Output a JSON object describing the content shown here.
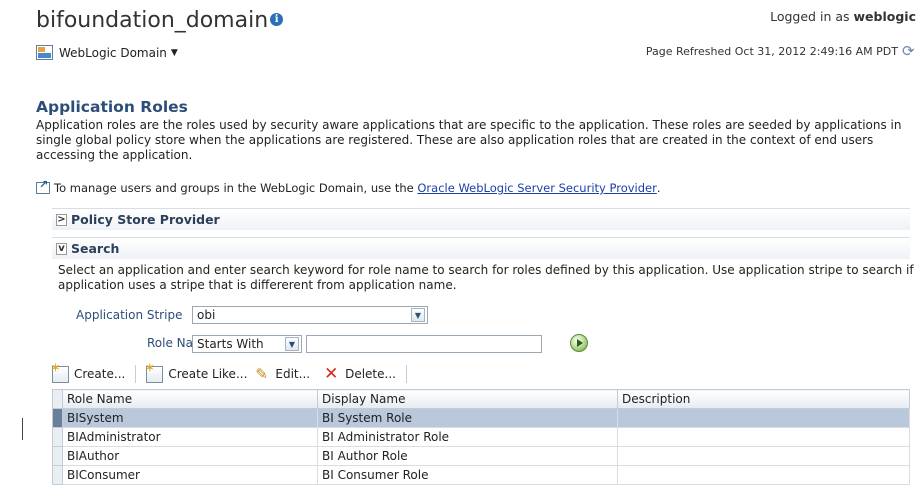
{
  "header": {
    "domain_title": "bifoundation_domain",
    "domain_menu_label": "WebLogic Domain",
    "logged_in_prefix": "Logged in as",
    "logged_in_user": "weblogic",
    "page_refreshed": "Page Refreshed Oct 31, 2012 2:49:16 AM PDT"
  },
  "main": {
    "title": "Application Roles",
    "description": "Application roles are the roles used by security aware applications that are specific to the application. These roles are seeded by applications in single global policy store when the applications are registered. These are also application roles that are created in the context of end users accessing the application.",
    "manage_text": "To manage users and groups in the WebLogic Domain, use the",
    "manage_link": "Oracle WebLogic Server Security Provider",
    "manage_suffix": "."
  },
  "panels": {
    "policy_store": "Policy Store Provider",
    "search": "Search"
  },
  "search": {
    "description": "Select an application and enter search keyword for role name to search for roles defined by this application. Use application stripe to search if application uses a stripe that is differerent from application name.",
    "app_stripe_label": "Application Stripe",
    "app_stripe_value": "obi",
    "role_name_label": "Role Name",
    "role_name_operator": "Starts With",
    "role_name_value": ""
  },
  "toolbar": {
    "create": "Create...",
    "create_like": "Create Like...",
    "edit": "Edit...",
    "delete": "Delete..."
  },
  "table": {
    "columns": [
      "Role Name",
      "Display Name",
      "Description"
    ],
    "rows": [
      {
        "role": "BISystem",
        "display": "BI System Role",
        "description": "",
        "selected": true
      },
      {
        "role": "BIAdministrator",
        "display": "BI Administrator Role",
        "description": "",
        "selected": false
      },
      {
        "role": "BIAuthor",
        "display": "BI Author Role",
        "description": "",
        "selected": false
      },
      {
        "role": "BIConsumer",
        "display": "BI Consumer Role",
        "description": "",
        "selected": false
      }
    ]
  },
  "icons": {
    "info": "info-icon",
    "domain": "weblogic-domain-icon",
    "refresh": "refresh-icon",
    "external": "external-link-icon",
    "go": "go-arrow-icon",
    "create": "create-icon",
    "edit": "pencil-icon",
    "delete": "red-x-icon"
  },
  "colors": {
    "heading": "#2d4e7a",
    "link": "#1a3fa8",
    "selected_row": "#b9c8db",
    "delete_icon": "#d62b1e"
  }
}
